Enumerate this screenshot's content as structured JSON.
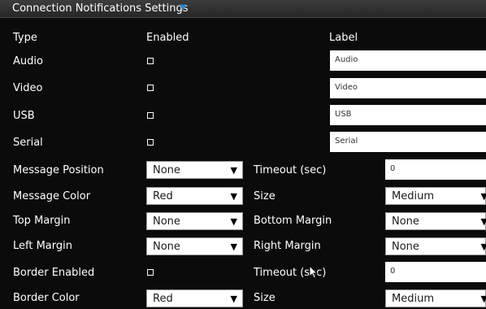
{
  "header": {
    "title": "Connection Notifications Settings",
    "caret_icon": "triangle-down"
  },
  "columns": {
    "type": "Type",
    "enabled": "Enabled",
    "label": "Label"
  },
  "types": [
    {
      "name": "Audio",
      "label_value": "Audio"
    },
    {
      "name": "Video",
      "label_value": "Video"
    },
    {
      "name": "USB",
      "label_value": "USB"
    },
    {
      "name": "Serial",
      "label_value": "Serial"
    }
  ],
  "settings": {
    "message_position": {
      "label": "Message Position",
      "value": "None"
    },
    "timeout_1": {
      "label": "Timeout (sec)",
      "value": "0"
    },
    "message_color": {
      "label": "Message Color",
      "value": "Red"
    },
    "size_1": {
      "label": "Size",
      "value": "Medium"
    },
    "top_margin": {
      "label": "Top Margin",
      "value": "None"
    },
    "bottom_margin": {
      "label": "Bottom Margin",
      "value": "None"
    },
    "left_margin": {
      "label": "Left Margin",
      "value": "None"
    },
    "right_margin": {
      "label": "Right Margin",
      "value": "None"
    },
    "border_enabled": {
      "label": "Border Enabled"
    },
    "timeout_2": {
      "label": "Timeout (sec)",
      "value": "0"
    },
    "border_color": {
      "label": "Border Color",
      "value": "Red"
    },
    "size_2": {
      "label": "Size",
      "value": "Medium"
    }
  },
  "icons": {
    "select_arrow": "▼",
    "checkbox": "empty-square"
  }
}
